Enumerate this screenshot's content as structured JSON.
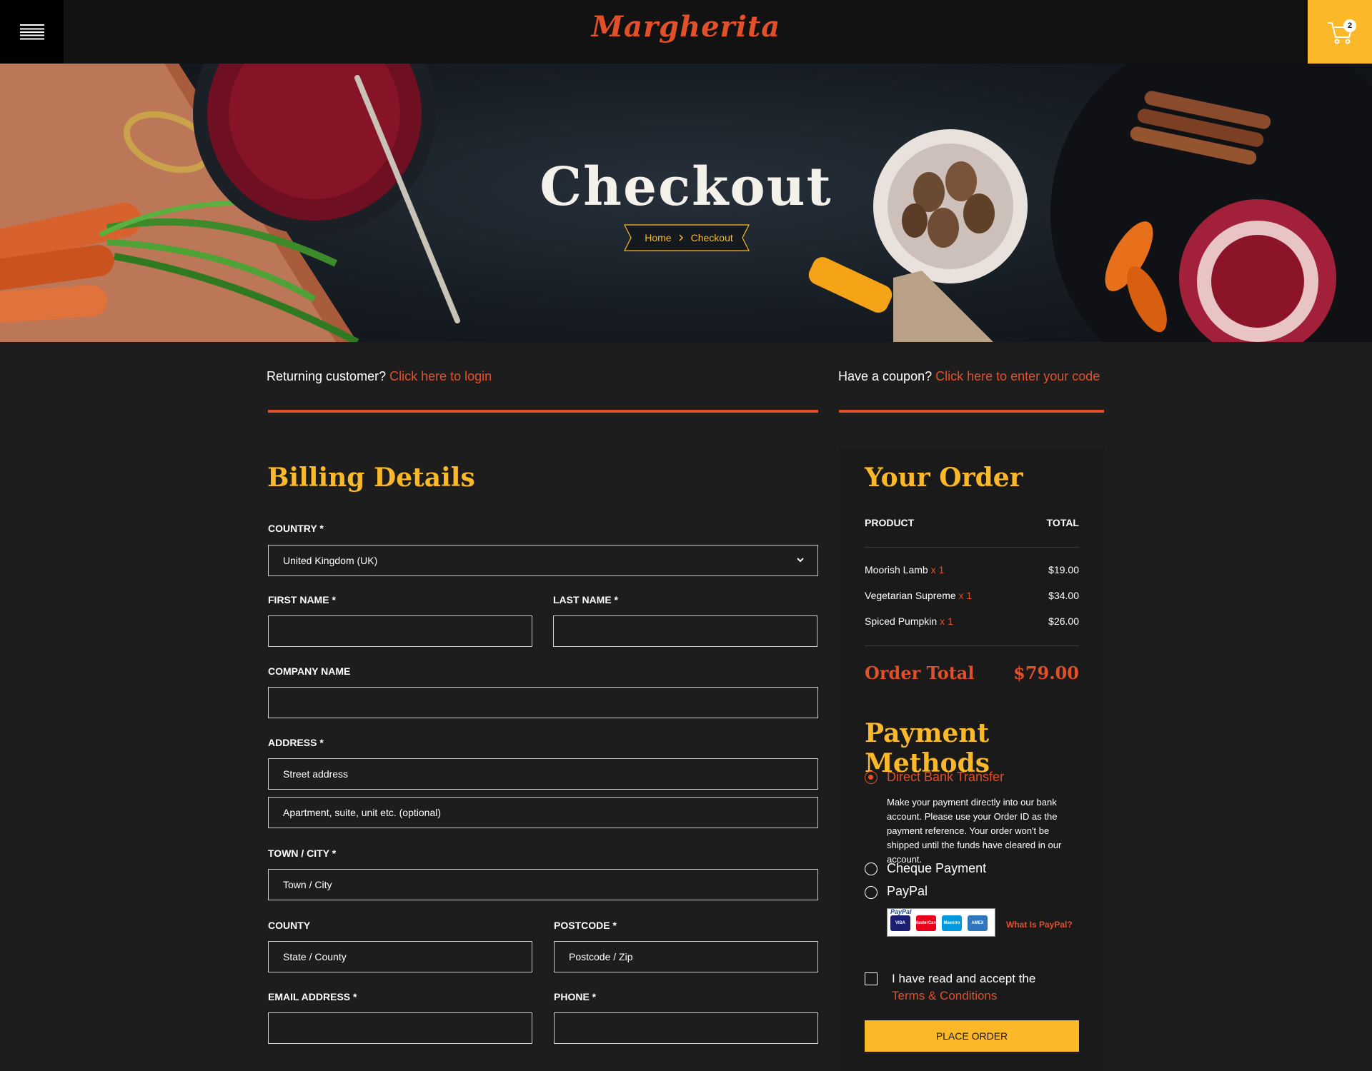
{
  "header": {
    "logo": "Margherita",
    "cart_count": "2",
    "icons": {
      "menu": "hamburger-icon",
      "cart": "cart-icon"
    }
  },
  "hero": {
    "title": "Checkout",
    "breadcrumb": {
      "home": "Home",
      "current": "Checkout"
    }
  },
  "notices": {
    "returning": {
      "text": "Returning customer?",
      "link": "Click here to login"
    },
    "coupon": {
      "text": "Have a coupon?",
      "link": "Click here to enter your code"
    }
  },
  "billing": {
    "title": "Billing Details",
    "country": {
      "label": "COUNTRY *",
      "value": "United Kingdom (UK)"
    },
    "first_name": {
      "label": "FIRST NAME *",
      "value": ""
    },
    "last_name": {
      "label": "LAST NAME *",
      "value": ""
    },
    "company": {
      "label": "COMPANY NAME",
      "value": ""
    },
    "address": {
      "label": "ADDRESS *",
      "street_placeholder": "Street address",
      "apt_placeholder": "Apartment, suite, unit etc. (optional)"
    },
    "town": {
      "label": "TOWN / CITY *",
      "placeholder": "Town / City"
    },
    "county": {
      "label": "COUNTY",
      "placeholder": "State / County"
    },
    "postcode": {
      "label": "POSTCODE *",
      "placeholder": "Postcode / Zip"
    },
    "email": {
      "label": "EMAIL ADDRESS *",
      "value": ""
    },
    "phone": {
      "label": "PHONE *",
      "value": ""
    }
  },
  "order": {
    "title": "Your Order",
    "col_product": "PRODUCT",
    "col_total": "TOTAL",
    "items": [
      {
        "name": "Moorish Lamb",
        "qty": "x 1",
        "total": "$19.00"
      },
      {
        "name": "Vegetarian Supreme",
        "qty": "x 1",
        "total": "$34.00"
      },
      {
        "name": "Spiced Pumpkin",
        "qty": "x 1",
        "total": "$26.00"
      }
    ],
    "total_label": "Order Total",
    "total_value": "$79.00"
  },
  "payment": {
    "title": "Payment Methods",
    "methods": [
      {
        "label": "Direct Bank Transfer",
        "selected": true
      },
      {
        "label": "Cheque Payment",
        "selected": false
      },
      {
        "label": "PayPal",
        "selected": false
      }
    ],
    "bank_description": "Make your payment directly into our bank account. Please use your Order ID as the payment reference. Your order won't be shipped until the funds have cleared in our account.",
    "paypal_badge": "PayPal",
    "cards": [
      "VISA",
      "MasterCard",
      "Maestro",
      "AMEX"
    ],
    "what_is_paypal": "What Is PayPal?",
    "terms_text": "I have read and accept the",
    "terms_link": "Terms & Conditions",
    "place_order": "PLACE ORDER"
  },
  "colors": {
    "accent_orange": "#e2502a",
    "accent_yellow": "#fbb829",
    "background": "#1d1d1d",
    "header": "#121212"
  }
}
